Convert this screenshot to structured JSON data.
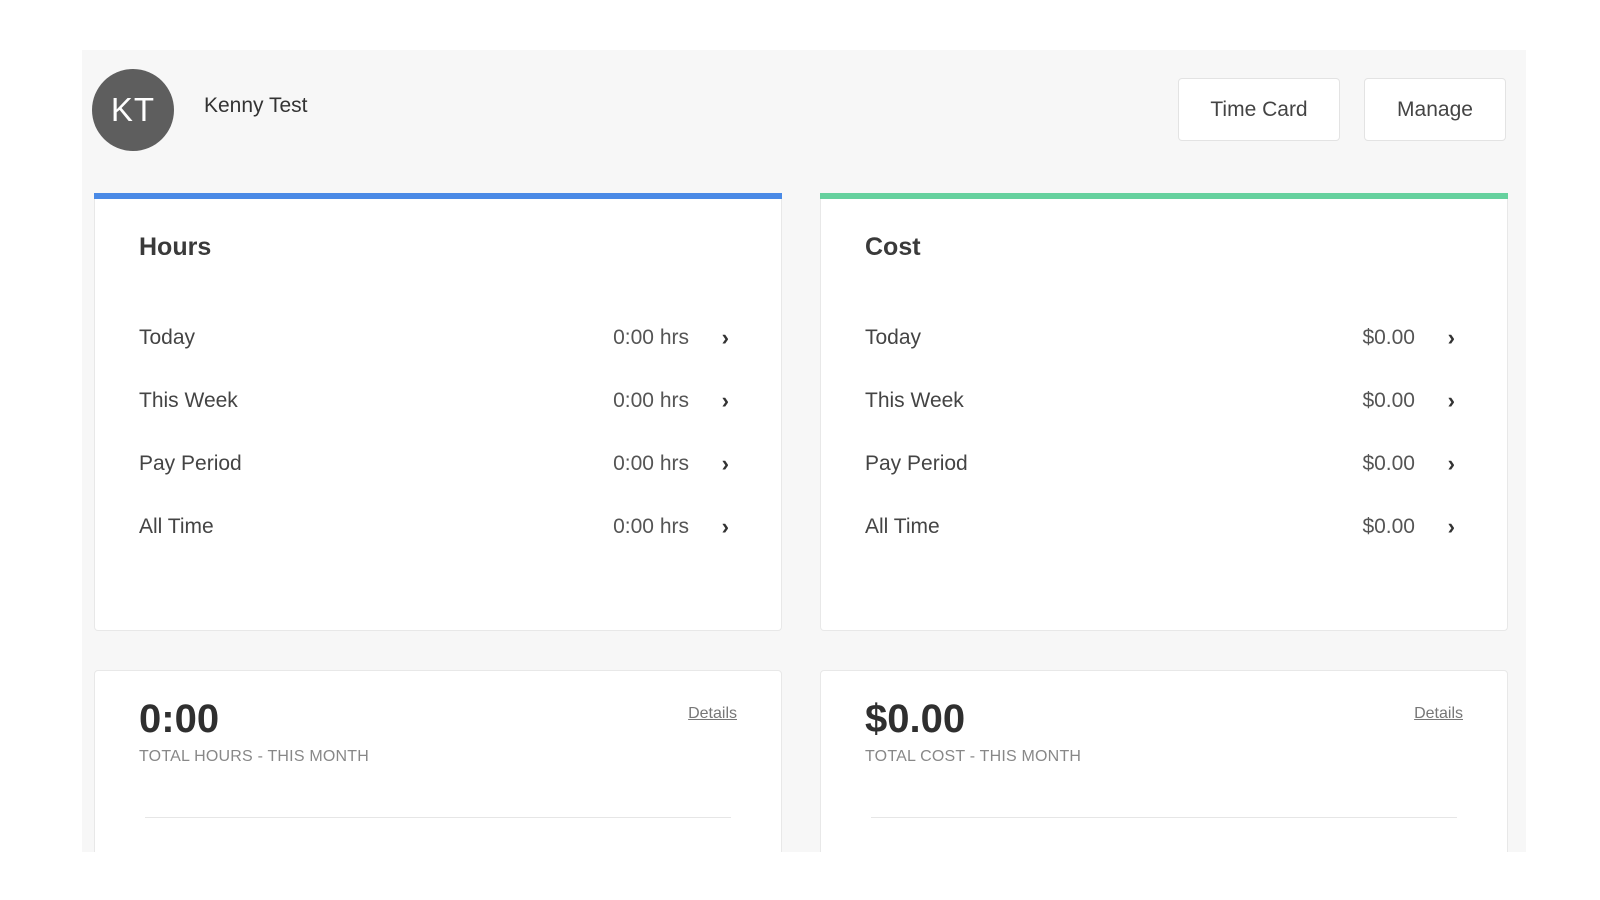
{
  "user": {
    "initials": "KT",
    "name": "Kenny Test"
  },
  "header": {
    "time_card_label": "Time Card",
    "manage_label": "Manage"
  },
  "colors": {
    "hours_accent": "#4a8ae6",
    "cost_accent": "#66d19e"
  },
  "hours": {
    "title": "Hours",
    "rows": [
      {
        "label": "Today",
        "value": "0:00 hrs"
      },
      {
        "label": "This Week",
        "value": "0:00 hrs"
      },
      {
        "label": "Pay Period",
        "value": "0:00 hrs"
      },
      {
        "label": "All Time",
        "value": "0:00 hrs"
      }
    ]
  },
  "cost": {
    "title": "Cost",
    "rows": [
      {
        "label": "Today",
        "value": "$0.00"
      },
      {
        "label": "This Week",
        "value": "$0.00"
      },
      {
        "label": "Pay Period",
        "value": "$0.00"
      },
      {
        "label": "All Time",
        "value": "$0.00"
      }
    ]
  },
  "summary_hours": {
    "value": "0:00",
    "caption": "TOTAL HOURS - THIS MONTH",
    "details_label": "Details"
  },
  "summary_cost": {
    "value": "$0.00",
    "caption": "TOTAL COST - THIS MONTH",
    "details_label": "Details"
  },
  "icons": {
    "row_chevron": "chevron-right-icon"
  }
}
